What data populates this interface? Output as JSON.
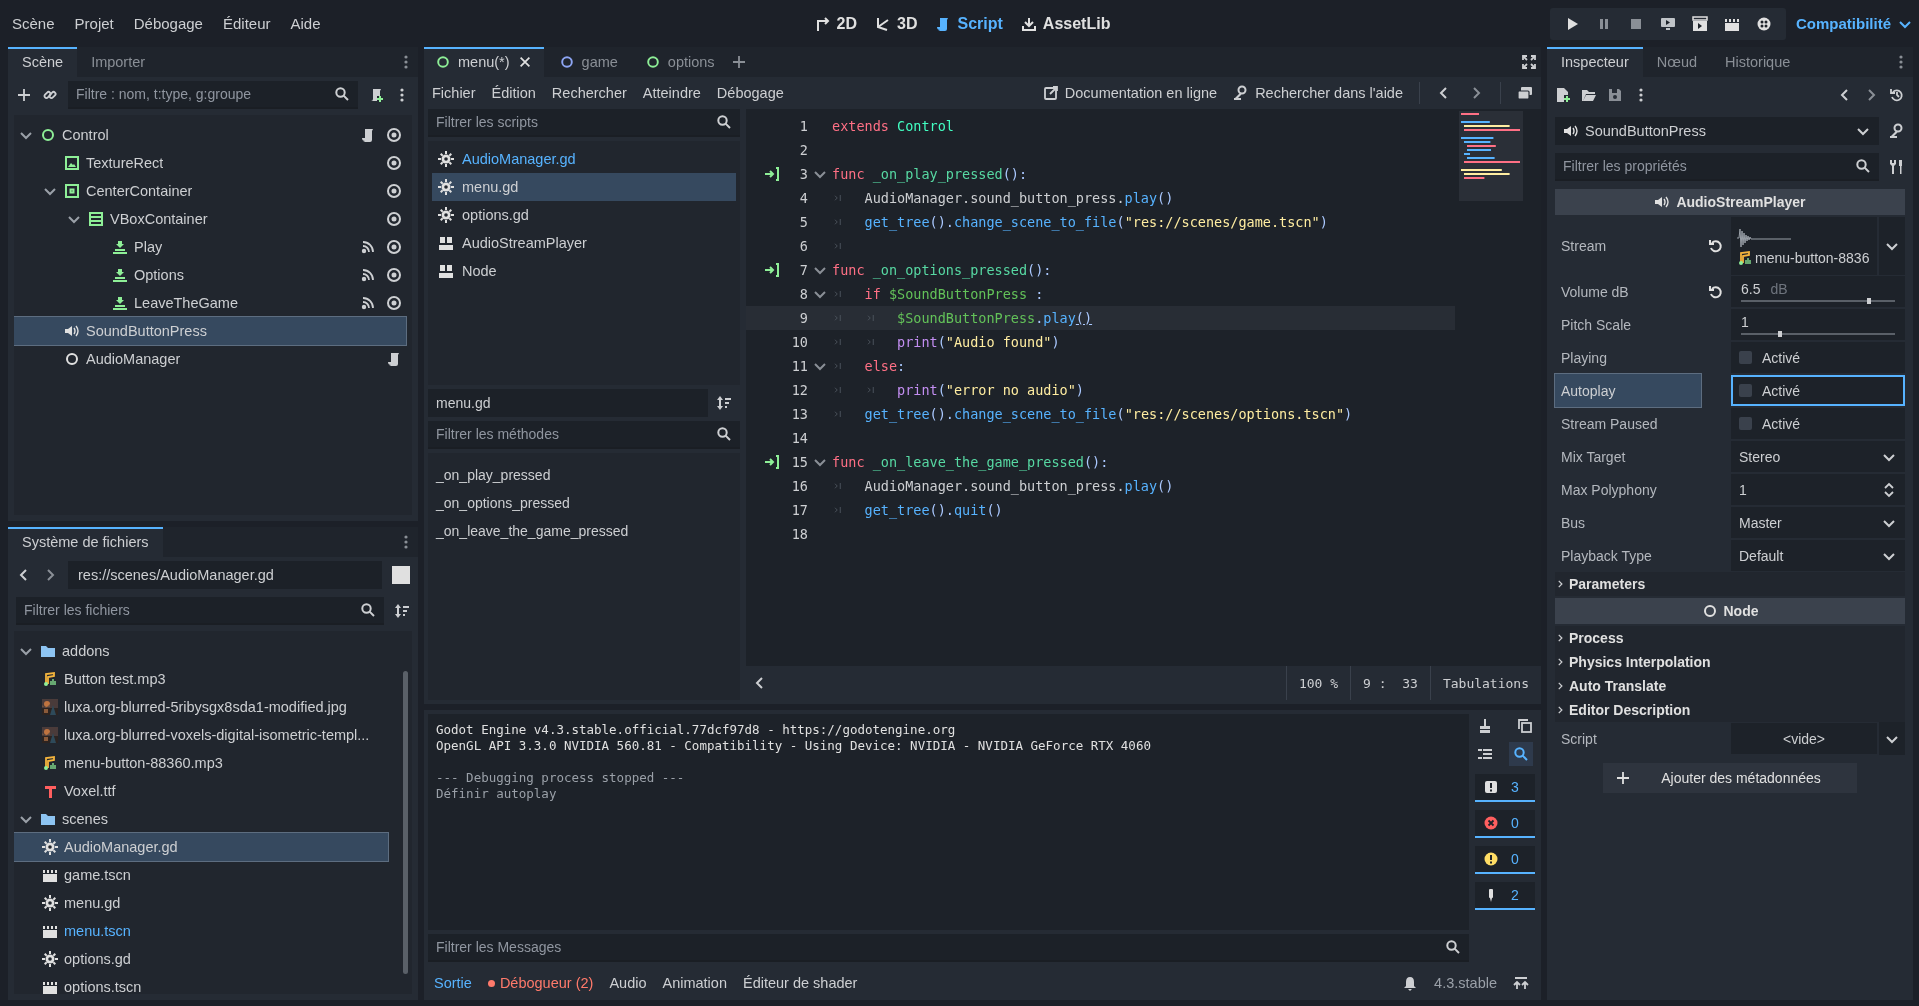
{
  "menubar": {
    "menus": [
      "Scène",
      "Projet",
      "Débogage",
      "Éditeur",
      "Aide"
    ],
    "workspaces": [
      {
        "label": "2D",
        "kind": "planar",
        "selected": false
      },
      {
        "label": "3D",
        "kind": "spatial",
        "selected": false
      },
      {
        "label": "Script",
        "kind": "script",
        "selected": true
      },
      {
        "label": "AssetLib",
        "kind": "assetlib",
        "selected": false
      }
    ],
    "renderer": "Compatibilité"
  },
  "scene_dock": {
    "tabs": [
      {
        "label": "Scène",
        "selected": true
      },
      {
        "label": "Importer",
        "selected": false
      }
    ],
    "filter": {
      "placeholder": "Filtre : nom, t:type, g:groupe"
    },
    "tree": [
      {
        "name": "Control",
        "kind": "control",
        "expanded": true,
        "selected": false,
        "script": true,
        "signals": false,
        "visible": true,
        "children": [
          {
            "name": "TextureRect",
            "kind": "texture-rect",
            "selected": false,
            "script": false,
            "signals": false,
            "visible": true
          },
          {
            "name": "CenterContainer",
            "kind": "center-container",
            "expanded": true,
            "selected": false,
            "script": false,
            "signals": false,
            "visible": true,
            "children": [
              {
                "name": "VBoxContainer",
                "kind": "vbox",
                "expanded": true,
                "selected": false,
                "script": false,
                "signals": false,
                "visible": true,
                "children": [
                  {
                    "name": "Play",
                    "kind": "button",
                    "selected": false,
                    "script": false,
                    "signals": true,
                    "visible": true
                  },
                  {
                    "name": "Options",
                    "kind": "button",
                    "selected": false,
                    "script": false,
                    "signals": true,
                    "visible": true
                  },
                  {
                    "name": "LeaveTheGame",
                    "kind": "button",
                    "selected": false,
                    "script": false,
                    "signals": true,
                    "visible": true
                  }
                ]
              }
            ]
          },
          {
            "name": "SoundButtonPress",
            "kind": "audio",
            "selected": true,
            "script": false,
            "signals": false
          },
          {
            "name": "AudioManager",
            "kind": "node",
            "selected": false,
            "script": true,
            "signals": false
          }
        ]
      }
    ]
  },
  "filesystem": {
    "tab": "Système de fichiers",
    "path": "res://scenes/AudioManager.gd",
    "filter": {
      "placeholder": "Filtrer les fichiers"
    },
    "tree": [
      {
        "name": "addons",
        "kind": "folder",
        "expanded": true,
        "selected": false,
        "highlighted": false,
        "children": [
          {
            "name": "Button test.mp3",
            "kind": "audio",
            "selected": false,
            "highlighted": false
          },
          {
            "name": "luxa.org-blurred-5ribysgx8sda1-modified.jpg",
            "selected": false,
            "highlighted": false
          },
          {
            "name": "luxa.org-blurred-voxels-digital-isometric-templ...",
            "selected": false,
            "highlighted": false
          },
          {
            "name": "menu-button-88360.mp3",
            "kind": "audio",
            "selected": false,
            "highlighted": false
          },
          {
            "name": "Voxel.ttf",
            "kind": "font",
            "selected": false,
            "highlighted": false
          }
        ]
      },
      {
        "name": "scenes",
        "kind": "folder",
        "expanded": true,
        "selected": false,
        "highlighted": false,
        "children": [
          {
            "name": "AudioManager.gd",
            "kind": "script",
            "selected": true,
            "highlighted": false
          },
          {
            "name": "game.tscn",
            "kind": "scene",
            "selected": false,
            "highlighted": false
          },
          {
            "name": "menu.gd",
            "kind": "script",
            "selected": false,
            "highlighted": false
          },
          {
            "name": "menu.tscn",
            "kind": "scene",
            "selected": false,
            "highlighted": true
          },
          {
            "name": "options.gd",
            "kind": "script",
            "selected": false,
            "highlighted": false
          },
          {
            "name": "options.tscn",
            "kind": "scene",
            "selected": false,
            "highlighted": false
          }
        ]
      }
    ]
  },
  "script_editor": {
    "tabs": [
      {
        "label": "menu(*)",
        "color": "#8eef97",
        "selected": true
      },
      {
        "label": "game",
        "color": "#8da5f3",
        "selected": false
      },
      {
        "label": "options",
        "color": "#8eef97",
        "selected": false
      }
    ],
    "menus": [
      "Fichier",
      "Édition",
      "Rechercher",
      "Atteindre",
      "Débogage"
    ],
    "help_buttons": [
      {
        "label": "Documentation en ligne",
        "kind": "online-docs"
      },
      {
        "label": "Rechercher dans l'aide",
        "kind": "search-help"
      }
    ],
    "scripts_filter": {
      "placeholder": "Filtrer les scripts"
    },
    "scripts": [
      {
        "name": "AudioManager.gd",
        "kind": "script",
        "selected": false,
        "highlighted": true
      },
      {
        "name": "menu.gd",
        "kind": "script",
        "selected": true,
        "highlighted": false
      },
      {
        "name": "options.gd",
        "kind": "script",
        "selected": false,
        "highlighted": false
      },
      {
        "name": "AudioStreamPlayer",
        "kind": "doc",
        "selected": false,
        "highlighted": false
      },
      {
        "name": "Node",
        "kind": "doc",
        "selected": false,
        "highlighted": false
      }
    ],
    "current_script": "menu.gd",
    "methods_filter": {
      "placeholder": "Filtrer les méthodes"
    },
    "methods": [
      "_on_play_pressed",
      "_on_options_pressed",
      "_on_leave_the_game_pressed"
    ],
    "lines": [
      {
        "number": "1",
        "connected": false,
        "fold": false,
        "current": false,
        "tokens": [
          {
            "text": "extends ",
            "kind": "keyword"
          },
          {
            "text": "Control",
            "kind": "type"
          }
        ]
      },
      {
        "number": "2",
        "connected": false,
        "fold": false,
        "current": false
      },
      {
        "number": "3",
        "connected": true,
        "fold": true,
        "current": false,
        "tokens": [
          {
            "text": "func ",
            "kind": "keyword"
          },
          {
            "text": "_on_play_pressed",
            "kind": "function"
          },
          {
            "text": "():",
            "kind": "symbol"
          }
        ]
      },
      {
        "number": "4",
        "connected": false,
        "fold": false,
        "current": false,
        "tokens": [
          {
            "kind": "tab"
          },
          {
            "text": "AudioManager.sound_button_press.",
            "kind": "text"
          },
          {
            "text": "play",
            "kind": "call"
          },
          {
            "text": "()",
            "kind": "symbol"
          }
        ]
      },
      {
        "number": "5",
        "connected": false,
        "fold": false,
        "current": false,
        "tokens": [
          {
            "kind": "tab"
          },
          {
            "text": "get_tree",
            "kind": "call"
          },
          {
            "text": "().",
            "kind": "symbol"
          },
          {
            "text": "change_scene_to_file",
            "kind": "call"
          },
          {
            "text": "(",
            "kind": "symbol"
          },
          {
            "text": "\"res://scenes/game.tscn\"",
            "kind": "string"
          },
          {
            "text": ")",
            "kind": "symbol"
          }
        ]
      },
      {
        "number": "6",
        "connected": false,
        "fold": false,
        "current": false,
        "tokens": [
          {
            "kind": "tab"
          }
        ]
      },
      {
        "number": "7",
        "connected": true,
        "fold": true,
        "current": false,
        "tokens": [
          {
            "text": "func ",
            "kind": "keyword"
          },
          {
            "text": "_on_options_pressed",
            "kind": "function"
          },
          {
            "text": "():",
            "kind": "symbol"
          }
        ]
      },
      {
        "number": "8",
        "connected": false,
        "fold": true,
        "current": false,
        "tokens": [
          {
            "kind": "tab"
          },
          {
            "text": "if ",
            "kind": "keyword"
          },
          {
            "text": "$SoundButtonPress",
            "kind": "nodepath"
          },
          {
            "text": " :",
            "kind": "symbol"
          }
        ]
      },
      {
        "number": "9",
        "connected": false,
        "fold": false,
        "current": true,
        "tokens": [
          {
            "kind": "tab"
          },
          {
            "kind": "tab"
          },
          {
            "text": "$SoundButtonPress",
            "kind": "nodepath"
          },
          {
            "text": ".",
            "kind": "symbol"
          },
          {
            "text": "play",
            "kind": "call"
          },
          {
            "text": "()",
            "kind": "matched"
          }
        ]
      },
      {
        "number": "10",
        "connected": false,
        "fold": false,
        "current": false,
        "tokens": [
          {
            "kind": "tab"
          },
          {
            "kind": "tab"
          },
          {
            "text": "print",
            "kind": "builtin"
          },
          {
            "text": "(",
            "kind": "symbol"
          },
          {
            "text": "\"Audio found\"",
            "kind": "string"
          },
          {
            "text": ")",
            "kind": "symbol"
          }
        ]
      },
      {
        "number": "11",
        "connected": false,
        "fold": true,
        "current": false,
        "tokens": [
          {
            "kind": "tab"
          },
          {
            "text": "else",
            "kind": "keyword"
          },
          {
            "text": ":",
            "kind": "symbol"
          }
        ]
      },
      {
        "number": "12",
        "connected": false,
        "fold": false,
        "current": false,
        "tokens": [
          {
            "kind": "tab"
          },
          {
            "kind": "tab"
          },
          {
            "text": "print",
            "kind": "builtin"
          },
          {
            "text": "(",
            "kind": "symbol"
          },
          {
            "text": "\"error no audio\"",
            "kind": "string"
          },
          {
            "text": ")",
            "kind": "symbol"
          }
        ]
      },
      {
        "number": "13",
        "connected": false,
        "fold": false,
        "current": false,
        "tokens": [
          {
            "kind": "tab"
          },
          {
            "text": "get_tree",
            "kind": "call"
          },
          {
            "text": "().",
            "kind": "symbol"
          },
          {
            "text": "change_scene_to_file",
            "kind": "call"
          },
          {
            "text": "(",
            "kind": "symbol"
          },
          {
            "text": "\"res://scenes/options.tscn\"",
            "kind": "string"
          },
          {
            "text": ")",
            "kind": "symbol"
          }
        ]
      },
      {
        "number": "14",
        "connected": false,
        "fold": false,
        "current": false
      },
      {
        "number": "15",
        "connected": true,
        "fold": true,
        "current": false,
        "tokens": [
          {
            "text": "func ",
            "kind": "keyword"
          },
          {
            "text": "_on_leave_the_game_pressed",
            "kind": "function"
          },
          {
            "text": "():",
            "kind": "symbol"
          }
        ]
      },
      {
        "number": "16",
        "connected": false,
        "fold": false,
        "current": false,
        "tokens": [
          {
            "kind": "tab"
          },
          {
            "text": "AudioManager.sound_button_press.",
            "kind": "text"
          },
          {
            "text": "play",
            "kind": "call"
          },
          {
            "text": "()",
            "kind": "symbol"
          }
        ]
      },
      {
        "number": "17",
        "connected": false,
        "fold": false,
        "current": false,
        "tokens": [
          {
            "kind": "tab"
          },
          {
            "text": "get_tree",
            "kind": "call"
          },
          {
            "text": "().",
            "kind": "symbol"
          },
          {
            "text": "quit",
            "kind": "call"
          },
          {
            "text": "()",
            "kind": "symbol"
          }
        ]
      },
      {
        "number": "18",
        "connected": false,
        "fold": false,
        "current": false
      }
    ],
    "status": {
      "zoom": "100 %",
      "position": "9 :  33",
      "indentation": "Tabulations"
    }
  },
  "output": {
    "lines": [
      {
        "text": "Godot Engine v4.3.stable.official.77dcf97d8 - https://godotengine.org",
        "kind": "normal"
      },
      {
        "text": "OpenGL API 3.3.0 NVIDIA 560.81 - Compatibility - Using Device: NVIDIA - NVIDIA GeForce RTX 4060",
        "kind": "normal"
      },
      {
        "kind": "blank"
      },
      {
        "text": "--- Debugging process stopped ---",
        "kind": "dim"
      },
      {
        "text": "Définir autoplay",
        "kind": "dim"
      }
    ],
    "filter": {
      "placeholder": "Filtrer les Messages"
    },
    "counters": [
      {
        "kind": "message",
        "count": "3",
        "on": true
      },
      {
        "kind": "error",
        "count": "0",
        "on": true
      },
      {
        "kind": "warning",
        "count": "0",
        "on": true
      },
      {
        "kind": "editor",
        "count": "2",
        "on": true
      }
    ]
  },
  "bottom_tabs": [
    {
      "label": "Sortie",
      "kind": "normal",
      "selected": true
    },
    {
      "label": "Débogueur (2)",
      "kind": "alert",
      "selected": false
    },
    {
      "label": "Audio",
      "kind": "normal",
      "selected": false
    },
    {
      "label": "Animation",
      "kind": "normal",
      "selected": false
    },
    {
      "label": "Éditeur de shader",
      "kind": "normal",
      "selected": false
    }
  ],
  "version": "4.3.stable",
  "inspector": {
    "tabs": [
      {
        "label": "Inspecteur",
        "selected": true
      },
      {
        "label": "Nœud",
        "selected": false
      },
      {
        "label": "Historique",
        "selected": false
      }
    ],
    "node": "SoundButtonPress",
    "filter": {
      "placeholder": "Filtrer les propriétés"
    },
    "rows": [
      {
        "kind": "audio-category",
        "label": "AudioStreamPlayer"
      },
      {
        "kind": "resource",
        "label": "Stream",
        "value": "menu-button-8836",
        "reset": true,
        "selected": false
      },
      {
        "kind": "slider",
        "label": "Volume dB",
        "value": "6.5",
        "suffix": "dB",
        "level": 0.83,
        "reset": true,
        "selected": false
      },
      {
        "kind": "slider",
        "label": "Pitch Scale",
        "value": "1",
        "level": 0.25,
        "reset": false,
        "selected": false
      },
      {
        "kind": "checkbox",
        "label": "Playing",
        "value": "Activé",
        "checked": false,
        "reset": false,
        "selected": false
      },
      {
        "kind": "checkbox",
        "label": "Autoplay",
        "value": "Activé",
        "checked": false,
        "reset": false,
        "selected": true
      },
      {
        "kind": "checkbox",
        "label": "Stream Paused",
        "value": "Activé",
        "checked": false,
        "reset": false,
        "selected": false
      },
      {
        "kind": "dropdown",
        "label": "Mix Target",
        "value": "Stereo",
        "reset": false,
        "selected": false
      },
      {
        "kind": "spin",
        "label": "Max Polyphony",
        "value": "1",
        "reset": false,
        "selected": false
      },
      {
        "kind": "dropdown",
        "label": "Bus",
        "value": "Master",
        "reset": false,
        "selected": false
      },
      {
        "kind": "dropdown",
        "label": "Playback Type",
        "value": "Default",
        "reset": false,
        "selected": false
      },
      {
        "kind": "group",
        "label": "Parameters",
        "expanded": false
      },
      {
        "kind": "node-category",
        "label": "Node"
      },
      {
        "kind": "group",
        "label": "Process",
        "expanded": false
      },
      {
        "kind": "group",
        "label": "Physics Interpolation",
        "expanded": false
      },
      {
        "kind": "group",
        "label": "Auto Translate",
        "expanded": false
      },
      {
        "kind": "group",
        "label": "Editor Description",
        "expanded": false
      },
      {
        "kind": "empty-resource",
        "label": "Script",
        "value": "<vide>",
        "reset": false,
        "selected": false
      }
    ],
    "add_button": "Ajouter des métadonnées"
  }
}
